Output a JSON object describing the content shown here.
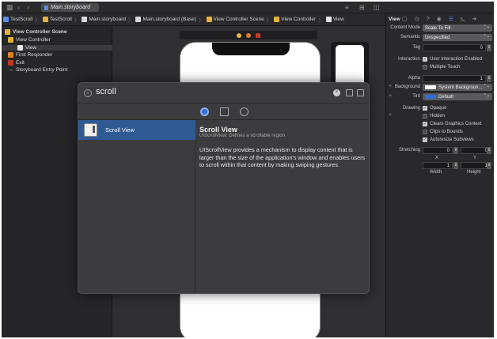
{
  "window": {
    "tab_title": "Main.storyboard"
  },
  "breadcrumb": [
    {
      "label": "TestScroll",
      "icon": "project-icon",
      "color": "#5b8de0"
    },
    {
      "label": "TestScroll",
      "icon": "folder-icon",
      "color": "#e5b33d"
    },
    {
      "label": "Main.storyboard",
      "icon": "storyboard-icon",
      "color": "#d9d9d9"
    },
    {
      "label": "Main.storyboard (Base)",
      "icon": "storyboard-icon",
      "color": "#d9d9d9"
    },
    {
      "label": "View Controller Scene",
      "icon": "scene-icon",
      "color": "#e5b33d"
    },
    {
      "label": "View Controller",
      "icon": "view-controller-icon",
      "color": "#e5b33d"
    },
    {
      "label": "View",
      "icon": "view-icon",
      "color": "#e8e8e8"
    }
  ],
  "outline": {
    "scene_title": "View Controller Scene",
    "items": [
      {
        "label": "View Controller",
        "indent": 1,
        "icon": "view-controller-icon"
      },
      {
        "label": "View",
        "indent": 2,
        "icon": "view-icon",
        "selected": true
      },
      {
        "label": "First Responder",
        "indent": 1,
        "icon": "first-responder-icon"
      },
      {
        "label": "Exit",
        "indent": 1,
        "icon": "exit-icon"
      },
      {
        "label": "Storyboard Entry Point",
        "indent": 1,
        "icon": "arrow-right-icon"
      }
    ]
  },
  "inspector": {
    "title": "View",
    "content_mode_label": "Content Mode",
    "content_mode_value": "Scale To Fill",
    "semantic_label": "Semantic",
    "semantic_value": "Unspecified",
    "tag_label": "Tag",
    "tag_value": "0",
    "interaction_label": "Interaction",
    "user_interaction_label": "User Interaction Enabled",
    "user_interaction_checked": true,
    "multiple_touch_label": "Multiple Touch",
    "multiple_touch_checked": false,
    "alpha_label": "Alpha",
    "alpha_value": "1",
    "background_label": "Background",
    "background_value": "System Backgroun...",
    "tint_label": "Tint",
    "tint_value": "Default",
    "drawing_label": "Drawing",
    "opaque_label": "Opaque",
    "hidden_label": "Hidden",
    "clears_label": "Clears Graphics Context",
    "clips_label": "Clips to Bounds",
    "autoresize_label": "Autoresize Subviews",
    "stretching_label": "Stretching",
    "stretch_x_value": "0",
    "stretch_y_value": "0",
    "stretch_w_value": "1",
    "stretch_h_value": "1",
    "x_label": "X",
    "y_label": "Y",
    "width_label": "Width",
    "height_label": "Height",
    "tint_color": "#2e6fd6"
  },
  "library": {
    "search_value": "scroll",
    "selected_item": "Scroll View",
    "detail_title": "Scroll View",
    "detail_subtitle": "UIScrollView: Defines a scrollable region",
    "detail_description": "UIScrollView provides a mechanism to display content that is larger than the size of the application's window and enables users to scroll within that content by making swiping gestures."
  },
  "colors": {
    "selection_blue": "#2f5a94",
    "accent_blue": "#2e6fd6"
  }
}
